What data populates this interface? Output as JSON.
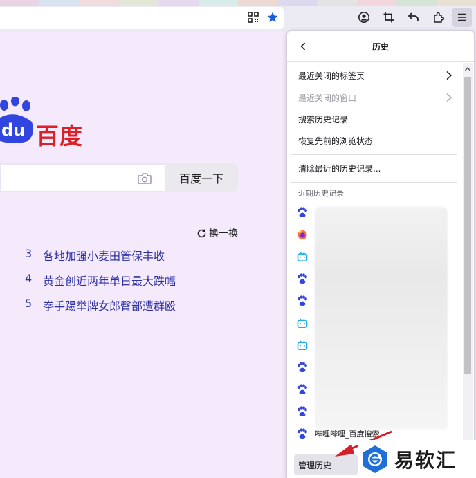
{
  "panel": {
    "title": "历史",
    "menu": [
      {
        "label": "最近关闭的标签页",
        "enabled": true,
        "has_submenu": true
      },
      {
        "label": "最近关闭的窗口",
        "enabled": false,
        "has_submenu": true
      },
      {
        "label": "搜索历史记录",
        "enabled": true,
        "has_submenu": false
      },
      {
        "label": "恢复先前的浏览状态",
        "enabled": true,
        "has_submenu": false
      }
    ],
    "clear_label": "清除最近的历史记录...",
    "recent_label": "近期历史记录",
    "history_items": [
      {
        "icon": "baidu-paw-icon",
        "title": ""
      },
      {
        "icon": "firefox-icon",
        "title": ""
      },
      {
        "icon": "bilibili-icon",
        "title": ""
      },
      {
        "icon": "baidu-paw-icon",
        "title": ""
      },
      {
        "icon": "baidu-paw-icon",
        "title": ""
      },
      {
        "icon": "bilibili-icon",
        "title": ""
      },
      {
        "icon": "bilibili-icon",
        "title": ""
      },
      {
        "icon": "baidu-paw-icon",
        "title": ""
      },
      {
        "icon": "baidu-paw-icon",
        "title": ""
      },
      {
        "icon": "baidu-paw-icon",
        "title": ""
      },
      {
        "icon": "baidu-paw-icon",
        "title": "哔哩哔哩_百度搜索"
      }
    ],
    "manage_label": "管理历史"
  },
  "page": {
    "logo_text": "百度",
    "search_button": "百度一下",
    "refresh_label": "换一换",
    "hot_list": [
      {
        "rank": "3",
        "text": "各地加强小麦田管保丰收"
      },
      {
        "rank": "4",
        "text": "黄金创近两年单日最大跌幅"
      },
      {
        "rank": "5",
        "text": "拳手踢举牌女郎臀部遭群殴"
      }
    ]
  },
  "watermark": {
    "text": "易软汇"
  },
  "colors": {
    "page_bg": "#f5eafc",
    "baidu_blue": "#3245df",
    "baidu_red": "#de1f26",
    "link_blue": "#2b2fa8",
    "bookmark_star": "#1a5fd6",
    "bilibili": "#23ade5",
    "arrow_red": "#d4202a"
  }
}
